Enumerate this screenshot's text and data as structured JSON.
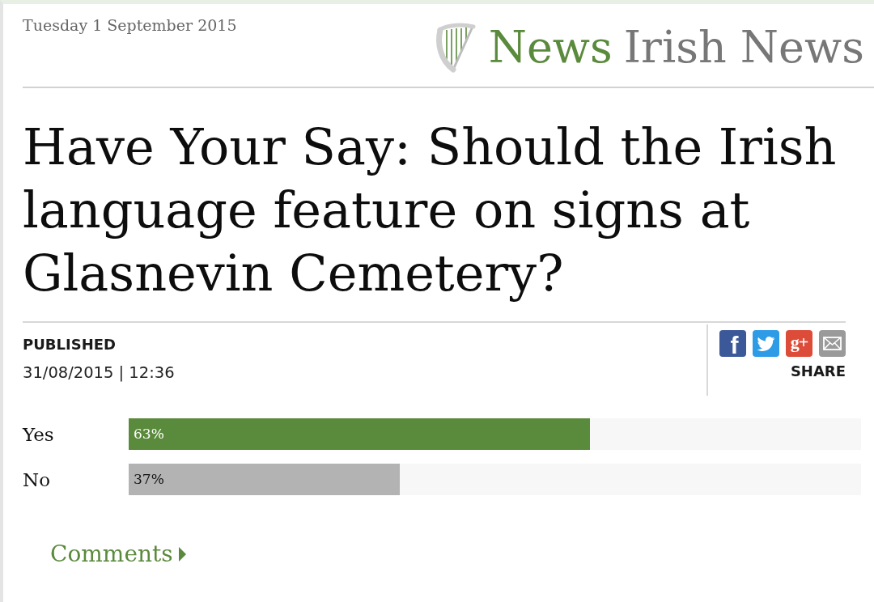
{
  "header": {
    "date": "Tuesday 1 September 2015",
    "logo": {
      "primary": "News",
      "secondary": "Irish News"
    }
  },
  "article": {
    "headline": "Have Your Say: Should the Irish language feature on signs at Glasnevin Cemetery?",
    "published_label": "PUBLISHED",
    "published": "31/08/2015 | 12:36"
  },
  "share": {
    "buttons": [
      {
        "kind": "facebook",
        "glyph": "f"
      },
      {
        "kind": "twitter"
      },
      {
        "kind": "google-plus",
        "glyph": "g+"
      },
      {
        "kind": "email"
      }
    ],
    "label": "SHARE"
  },
  "poll": {
    "options": [
      {
        "label": "Yes",
        "value": "63%",
        "level": 0.63,
        "color": "#5a8a3c"
      },
      {
        "label": "No",
        "value": "37%",
        "level": 0.37,
        "color": "#b3b3b3"
      }
    ]
  },
  "comments": {
    "label": "Comments"
  }
}
